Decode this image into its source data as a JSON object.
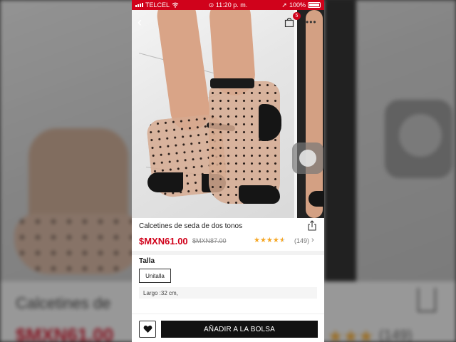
{
  "status_bar": {
    "carrier": "TELCEL",
    "time": "11:20 p. m.",
    "battery": "100%"
  },
  "header": {
    "bag_count": "5"
  },
  "product": {
    "title": "Calcetines de seda de dos tonos",
    "price": "$MXN61.00",
    "old_price": "$MXN87.00",
    "rating_count": "(149)",
    "rating": 4.5
  },
  "size": {
    "label": "Talla",
    "option": "Unitalla",
    "length": "Largo :32 cm,"
  },
  "actions": {
    "add_to_bag": "AÑADIR A LA BOLSA"
  },
  "background_copy": {
    "title": "Calcetines de",
    "price": "$MXN61.00",
    "rating_count": "(149)"
  },
  "colors": {
    "brand_red": "#d0021b",
    "button_black": "#111111",
    "star": "#f5a623"
  }
}
